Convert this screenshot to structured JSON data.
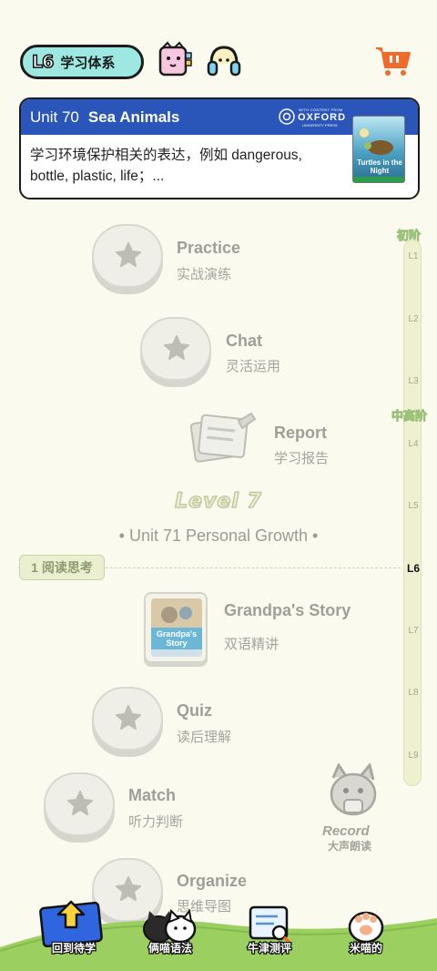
{
  "header": {
    "level_badge": "L6",
    "level_label": "学习体系"
  },
  "unit_card": {
    "unit_label": "Unit 70",
    "unit_title": "Sea Animals",
    "publisher_tagline": "WITH CONTENT FROM",
    "publisher_name": "OXFORD",
    "publisher_sub": "UNIVERSITY PRESS",
    "description": "学习环境保护相关的表达，例如 dangerous, bottle, plastic, life；...",
    "book_title": "Turtles in the Night"
  },
  "track": {
    "stage_beginner": "初阶",
    "stage_mid": "中高阶",
    "levels": [
      "L1",
      "L2",
      "L3",
      "L4",
      "L5",
      "L6",
      "L7",
      "L8",
      "L9"
    ],
    "current_level": "L6"
  },
  "nodes": {
    "practice": {
      "title": "Practice",
      "subtitle": "实战演练"
    },
    "chat": {
      "title": "Chat",
      "subtitle": "灵活运用"
    },
    "report": {
      "title": "Report",
      "subtitle": "学习报告"
    },
    "story": {
      "title": "Grandpa's Story",
      "subtitle": "双语精讲",
      "cover_text": "Grandpa's Story"
    },
    "quiz": {
      "title": "Quiz",
      "subtitle": "读后理解"
    },
    "match": {
      "title": "Match",
      "subtitle": "听力判断"
    },
    "organize": {
      "title": "Organize",
      "subtitle": "思维导图"
    }
  },
  "level_section": {
    "heading": "Level 7",
    "unit_line": "• Unit 71  Personal Growth •",
    "step_tag": "1 阅读思考"
  },
  "mascot": {
    "label_en": "Record",
    "label_cn": "大声朗读"
  },
  "bottom_nav": {
    "items": [
      {
        "label": "回到待学",
        "icon": "up-arrow-book-icon"
      },
      {
        "label": "俩喵语法",
        "icon": "cats-icon"
      },
      {
        "label": "牛津测评",
        "icon": "magnifier-doc-icon"
      },
      {
        "label": "米喵的",
        "icon": "paw-icon"
      }
    ]
  },
  "colors": {
    "background": "#fbfaee",
    "card_header": "#2a56b9",
    "level_pill": "#9de8e1",
    "cart": "#f06a2a",
    "grass": "#9bcf5f"
  }
}
